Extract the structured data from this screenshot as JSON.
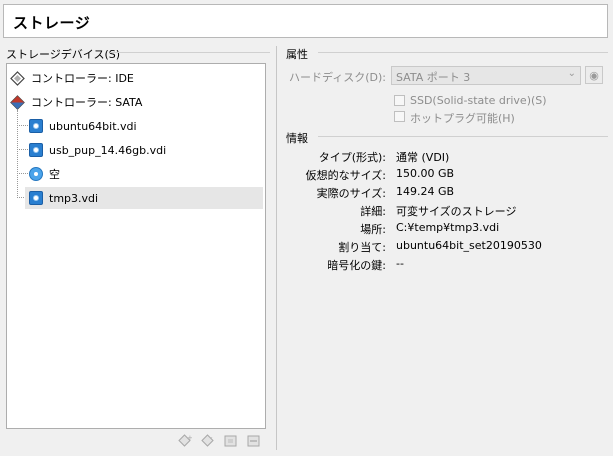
{
  "header": {
    "title": "ストレージ"
  },
  "left": {
    "group_label": "ストレージデバイス(S)",
    "tree": [
      {
        "label": "コントローラー: IDE",
        "icon": "ide-controller-icon",
        "level": 0
      },
      {
        "label": "コントローラー: SATA",
        "icon": "sata-controller-icon",
        "level": 0
      },
      {
        "label": "ubuntu64bit.vdi",
        "icon": "hard-disk-icon",
        "level": 1
      },
      {
        "label": "usb_pup_14.46gb.vdi",
        "icon": "hard-disk-icon",
        "level": 1
      },
      {
        "label": "空",
        "icon": "optical-disk-icon",
        "level": 1
      },
      {
        "label": "tmp3.vdi",
        "icon": "hard-disk-icon",
        "level": 1,
        "selected": true
      }
    ],
    "toolbar_icons": [
      "add-controller-icon",
      "remove-controller-icon",
      "add-attachment-icon",
      "remove-attachment-icon"
    ]
  },
  "attributes": {
    "group_label": "属性",
    "harddisk_label": "ハードディスク(D):",
    "harddisk_value": "SATA ポート 3",
    "ssd_label": "SSD(Solid-state drive)(S)",
    "hotplug_label": "ホットプラグ可能(H)"
  },
  "info": {
    "group_label": "情報",
    "rows": [
      {
        "label": "タイプ(形式):",
        "value": "通常 (VDI)"
      },
      {
        "label": "仮想的なサイズ:",
        "value": "150.00 GB"
      },
      {
        "label": "実際のサイズ:",
        "value": "149.24 GB"
      },
      {
        "label": "詳細:",
        "value": "可変サイズのストレージ"
      },
      {
        "label": "場所:",
        "value": "C:¥temp¥tmp3.vdi"
      },
      {
        "label": "割り当て:",
        "value": "ubuntu64bit_set20190530"
      },
      {
        "label": "暗号化の鍵:",
        "value": "--"
      }
    ]
  }
}
